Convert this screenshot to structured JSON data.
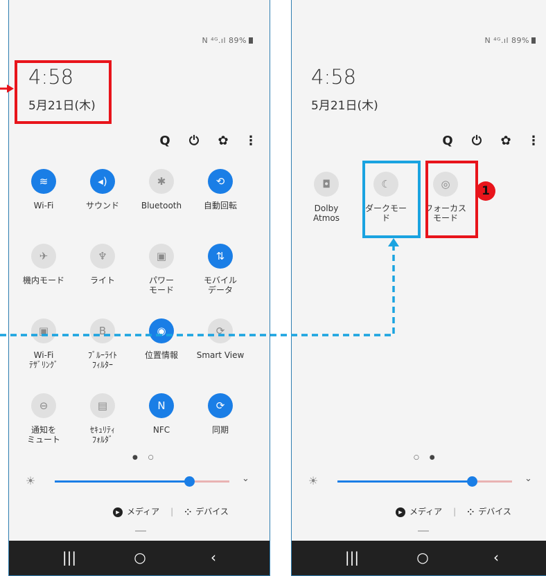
{
  "status": {
    "icons": "N ⁴ᴳ.ıl",
    "battery": "89%"
  },
  "clock": "4:58",
  "date": "5月21日(木)",
  "actions": {
    "search": "Q",
    "power": "⏻",
    "settings": "✿",
    "more": "⋮"
  },
  "left_tiles": [
    {
      "label": "Wi-Fi",
      "state": "on",
      "icon": "wifi-icon",
      "glyph": "≋"
    },
    {
      "label": "サウンド",
      "state": "on",
      "icon": "sound-icon",
      "glyph": "◂)"
    },
    {
      "label": "Bluetooth",
      "state": "off",
      "icon": "bluetooth-icon",
      "glyph": "✱"
    },
    {
      "label": "自動回転",
      "state": "on",
      "icon": "auto-rotate-icon",
      "glyph": "⟲"
    },
    {
      "label": "機内モード",
      "state": "off",
      "icon": "airplane-icon",
      "glyph": "✈"
    },
    {
      "label": "ライト",
      "state": "off",
      "icon": "flashlight-icon",
      "glyph": "♆"
    },
    {
      "label": "パワー\nモード",
      "state": "off",
      "icon": "power-mode-icon",
      "glyph": "▣"
    },
    {
      "label": "モバイル\nデータ",
      "state": "on",
      "icon": "mobile-data-icon",
      "glyph": "⇅"
    },
    {
      "label": "Wi-Fi\nﾃｻﾞﾘﾝｸﾞ",
      "state": "off",
      "icon": "tethering-icon",
      "glyph": "▣"
    },
    {
      "label": "ﾌﾞﾙｰﾗｲﾄ\nﾌｨﾙﾀｰ",
      "state": "off",
      "icon": "blue-light-icon",
      "glyph": "B"
    },
    {
      "label": "位置情報",
      "state": "on",
      "icon": "location-icon",
      "glyph": "◉"
    },
    {
      "label": "Smart View",
      "state": "off",
      "icon": "smart-view-icon",
      "glyph": "⟳"
    },
    {
      "label": "通知を\nミュート",
      "state": "off",
      "icon": "mute-icon",
      "glyph": "⊖"
    },
    {
      "label": "ｾｷｭﾘﾃｨ\nﾌｫﾙﾀﾞ",
      "state": "off",
      "icon": "secure-folder-icon",
      "glyph": "▤"
    },
    {
      "label": "NFC",
      "state": "on",
      "icon": "nfc-icon",
      "glyph": "N"
    },
    {
      "label": "同期",
      "state": "on",
      "icon": "sync-icon",
      "glyph": "⟳"
    }
  ],
  "right_tiles": [
    {
      "label": "Dolby\nAtmos",
      "state": "off",
      "icon": "dolby-icon",
      "glyph": "◘"
    },
    {
      "label": "ダークモー\nド",
      "state": "off",
      "icon": "dark-mode-icon",
      "glyph": "☾"
    },
    {
      "label": "フォーカス\nモード",
      "state": "off",
      "icon": "focus-mode-icon",
      "glyph": "◎"
    }
  ],
  "brightness": {
    "level": 0.72
  },
  "page_dots_left": "● ○",
  "page_dots_right": "○ ●",
  "media_label": "メディア",
  "devices_label": "デバイス",
  "nav": {
    "recent": "|||",
    "home": "○",
    "back": "‹"
  },
  "annotation_badge": "1",
  "colors": {
    "accent": "#1a7ee6",
    "highlight_red": "#e8141b",
    "highlight_blue": "#1aa3e0"
  }
}
